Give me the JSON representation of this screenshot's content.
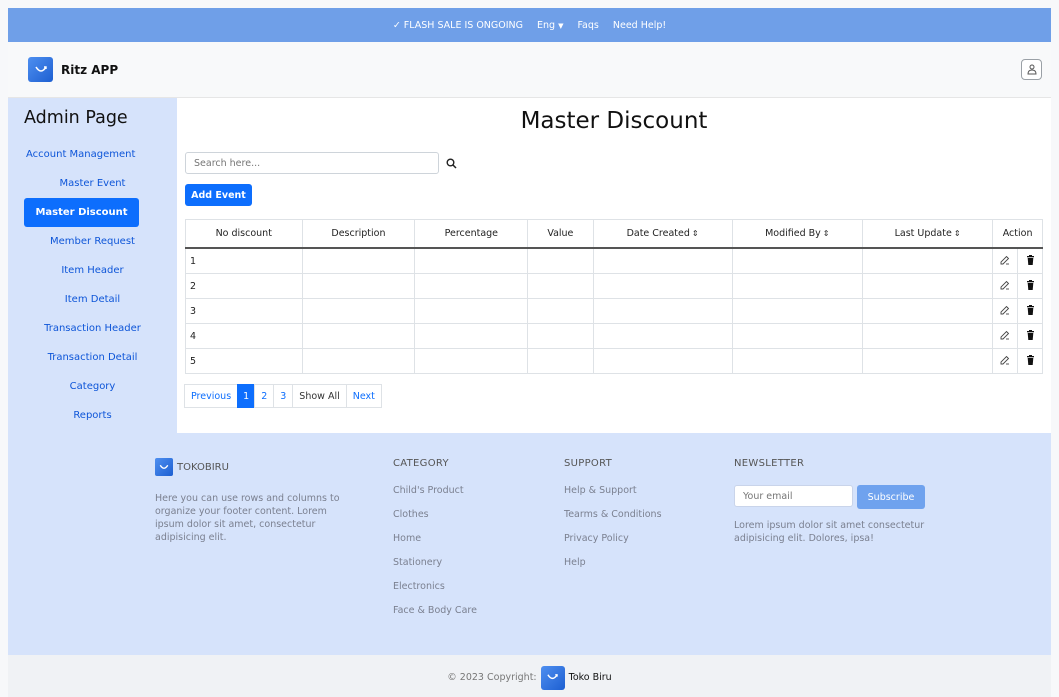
{
  "topbar": {
    "flash": "FLASH SALE IS ONGOING",
    "lang": "Eng",
    "faqs": "Faqs",
    "help": "Need Help!"
  },
  "navbar": {
    "brand": "Ritz APP"
  },
  "sidebar": {
    "title": "Admin Page",
    "items": [
      {
        "label": "Account Management",
        "active": false
      },
      {
        "label": "Master Event",
        "active": false
      },
      {
        "label": "Master Discount",
        "active": true
      },
      {
        "label": "Member Request",
        "active": false
      },
      {
        "label": "Item Header",
        "active": false
      },
      {
        "label": "Item Detail",
        "active": false
      },
      {
        "label": "Transaction Header",
        "active": false
      },
      {
        "label": "Transaction Detail",
        "active": false
      },
      {
        "label": "Category",
        "active": false
      },
      {
        "label": "Reports",
        "active": false
      }
    ]
  },
  "main": {
    "title": "Master Discount",
    "search_placeholder": "Search here...",
    "add_label": "Add Event",
    "columns": [
      "No discount",
      "Description",
      "Percentage",
      "Value",
      "Date Created",
      "Modified By",
      "Last Update",
      "Action"
    ],
    "sortable": [
      false,
      false,
      false,
      false,
      true,
      true,
      true,
      false
    ],
    "rows": [
      "1",
      "2",
      "3",
      "4",
      "5"
    ],
    "pager": {
      "previous": "Previous",
      "pages": [
        "1",
        "2",
        "3"
      ],
      "current": "1",
      "show_all": "Show All",
      "next": "Next"
    }
  },
  "footer": {
    "brand": "TOKOBIRU",
    "desc": "Here you can use rows and columns to organize your footer content. Lorem ipsum dolor sit amet, consectetur adipisicing elit.",
    "category_title": "CATEGORY",
    "category": [
      "Child's Product",
      "Clothes",
      "Home",
      "Stationery",
      "Electronics",
      "Face & Body Care"
    ],
    "support_title": "SUPPORT",
    "support": [
      "Help & Support",
      "Tearms & Conditions",
      "Privacy Policy",
      "Help"
    ],
    "newsletter_title": "NEWSLETTER",
    "newsletter_placeholder": "Your email",
    "subscribe": "Subscribe",
    "newsletter_text": "Lorem ipsum dolor sit amet consectetur adipisicing elit. Dolores, ipsa!"
  },
  "copyright": {
    "text": "© 2023 Copyright:",
    "brand": "Toko Biru"
  },
  "colors": {
    "accent": "#0d6efd",
    "topbar": "#6f9fe8",
    "sidebar_bg": "#d6e3fb",
    "link": "#0d55d8"
  }
}
